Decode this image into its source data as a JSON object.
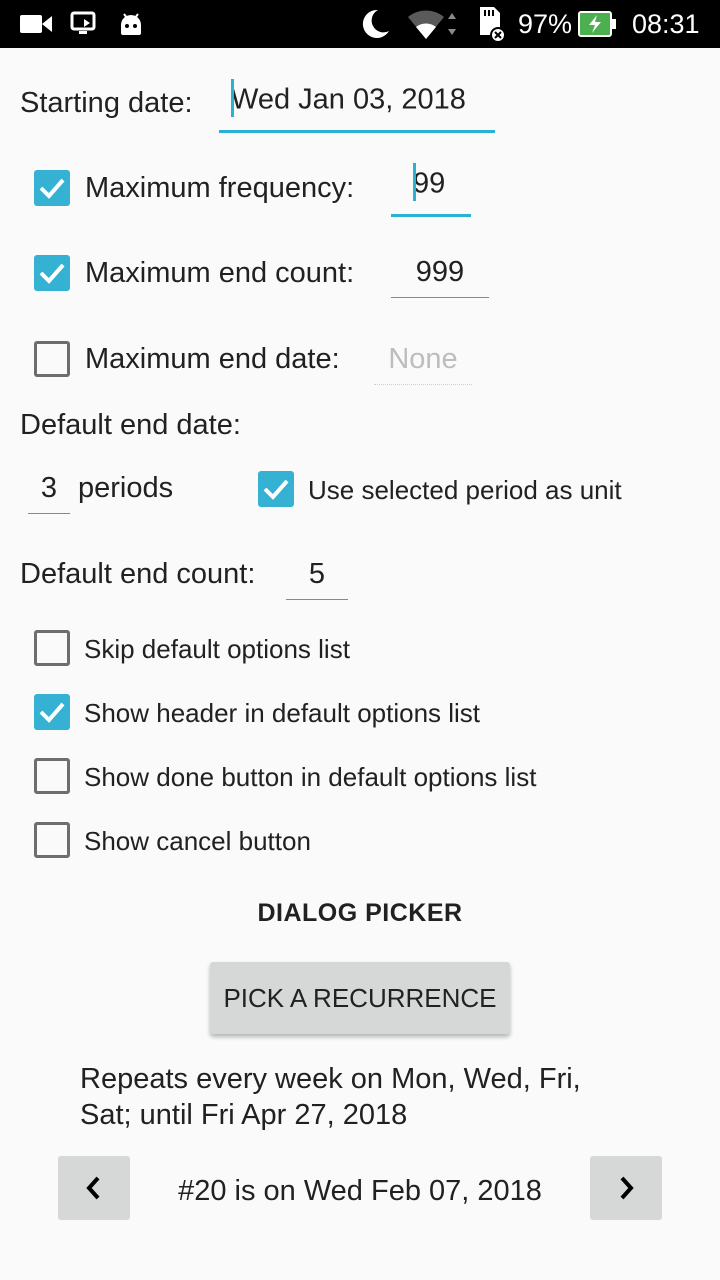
{
  "status_bar": {
    "battery_percent": "97%",
    "time": "08:31",
    "icons": [
      "video-camera-icon",
      "screen-cast-icon",
      "android-icon",
      "moon-icon",
      "wifi-icon",
      "sd-card-icon",
      "battery-charging-icon"
    ]
  },
  "starting_date": {
    "label": "Starting date:",
    "value": "Wed Jan 03, 2018"
  },
  "max_frequency": {
    "label": "Maximum frequency:",
    "value": "99",
    "checked": true
  },
  "max_end_count": {
    "label": "Maximum end count:",
    "value": "999",
    "checked": true
  },
  "max_end_date": {
    "label": "Maximum end date:",
    "placeholder": "None",
    "checked": false
  },
  "default_end_date": {
    "label": "Default end date:",
    "periods_value": "3",
    "periods_label": "periods",
    "use_selected_period_label": "Use selected period as unit",
    "use_selected_period_checked": true
  },
  "default_end_count": {
    "label": "Default end count:",
    "value": "5"
  },
  "options": [
    {
      "label": "Skip default options list",
      "checked": false
    },
    {
      "label": "Show header in default options list",
      "checked": true
    },
    {
      "label": "Show done button in default options list",
      "checked": false
    },
    {
      "label": "Show cancel button",
      "checked": false
    }
  ],
  "dialog_picker": {
    "title": "DIALOG PICKER",
    "button_label": "PICK A RECURRENCE",
    "summary_line1": "Repeats every week on Mon, Wed, Fri,",
    "summary_line2": "Sat; until Fri Apr 27, 2018",
    "occurrence_text": "#20 is on Wed Feb 07, 2018"
  },
  "colors": {
    "accent": "#35b2d3",
    "status_bar": "#000000",
    "battery": "#4caf50",
    "background": "#fafafa"
  }
}
